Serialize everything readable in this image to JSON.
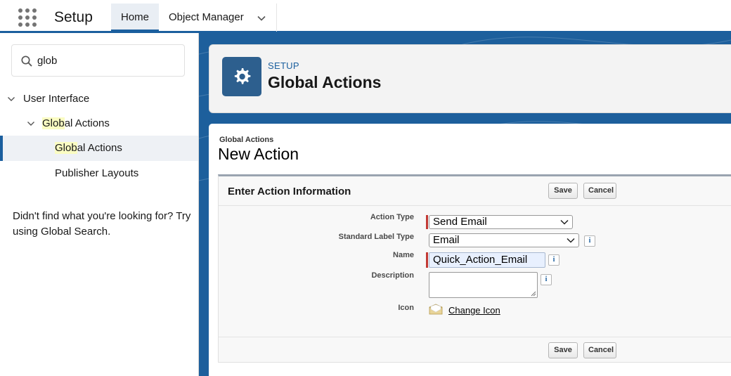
{
  "nav": {
    "app_title": "Setup",
    "tabs": [
      {
        "label": "Home"
      },
      {
        "label": "Object Manager"
      }
    ]
  },
  "sidebar": {
    "search_value": "glob",
    "tree": {
      "root": "User Interface",
      "group": {
        "match": "Glob",
        "rest": "al Actions"
      },
      "child_selected": {
        "match": "Glob",
        "rest": "al Actions"
      },
      "child_other": "Publisher Layouts"
    },
    "help_text": "Didn't find what you're looking for? Try using Global Search."
  },
  "header": {
    "setup_label": "SETUP",
    "title": "Global Actions"
  },
  "content": {
    "breadcrumb": "Global Actions",
    "title": "New Action",
    "section_title": "Enter Action Information",
    "save_label": "Save",
    "cancel_label": "Cancel",
    "fields": {
      "action_type": {
        "label": "Action Type",
        "value": "Send Email"
      },
      "standard_label_type": {
        "label": "Standard Label Type",
        "value": "Email"
      },
      "name": {
        "label": "Name",
        "value": "Quick_Action_Email"
      },
      "description": {
        "label": "Description",
        "value": ""
      },
      "icon": {
        "label": "Icon",
        "link": "Change Icon"
      }
    },
    "info_glyph": "i"
  },
  "colors": {
    "brand_blue": "#1b5f9e",
    "required_red": "#c23934",
    "highlight": "#fafcc2"
  }
}
